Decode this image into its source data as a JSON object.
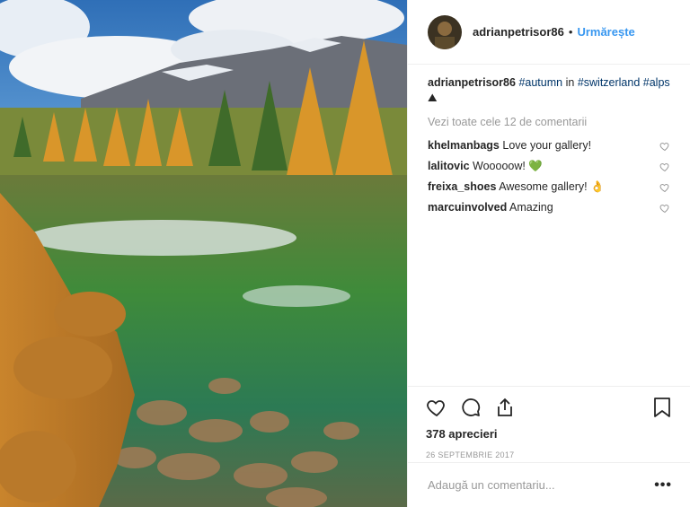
{
  "header": {
    "username": "adrianpetrisor86",
    "separator": "•",
    "follow_label": "Urmărește"
  },
  "caption": {
    "username": "adrianpetrisor86",
    "tag1": "#autumn",
    "in_word": "in",
    "tag2": "#switzerland",
    "tag3": "#alps",
    "emoji": "⛰"
  },
  "view_all": "Vezi toate cele 12 de comentarii",
  "comments": [
    {
      "user": "khelmanbags",
      "text": "Love your gallery!",
      "emoji": ""
    },
    {
      "user": "lalitovic",
      "text": "Wooooow!",
      "emoji": "💚"
    },
    {
      "user": "freixa_shoes",
      "text": "Awesome gallery!",
      "emoji": "👌"
    },
    {
      "user": "marcuinvolved",
      "text": "Amazing",
      "emoji": ""
    }
  ],
  "likes": "378 aprecieri",
  "date": "26 SEPTEMBRIE 2017",
  "add_comment": {
    "placeholder": "Adaugă un comentariu..."
  },
  "more_label": "•••",
  "icons": {
    "like": "heart-icon",
    "comment": "comment-bubble-icon",
    "share": "share-icon",
    "save": "bookmark-icon",
    "more": "more-options-icon"
  },
  "colors": {
    "link": "#003569",
    "follow": "#3897f0",
    "muted": "#999999"
  }
}
